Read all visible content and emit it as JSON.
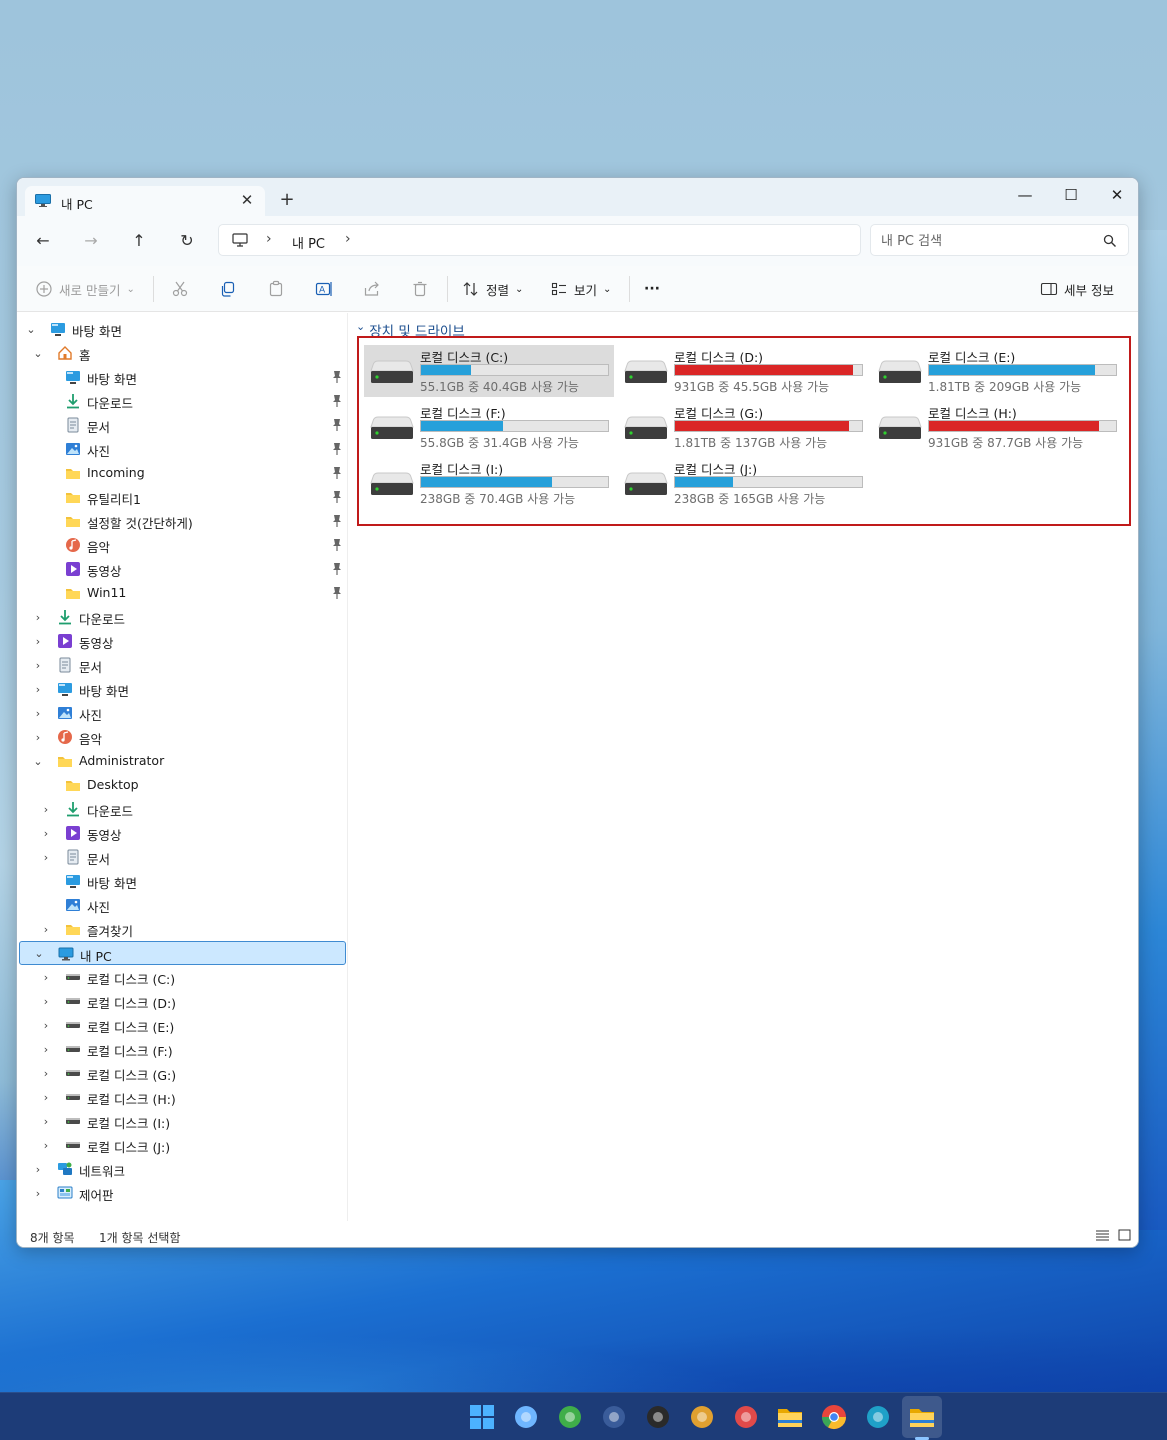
{
  "window": {
    "tab_title": "내 PC",
    "tab_close": "✕",
    "new_tab": "+",
    "minimize": "—",
    "maximize": "☐",
    "close": "✕"
  },
  "nav": {
    "back": "←",
    "forward": "→",
    "up": "↑",
    "refresh": "↻",
    "breadcrumb": [
      "내 PC"
    ],
    "sep": "›",
    "search_placeholder": "내 PC 검색"
  },
  "toolbar": {
    "new_label": "새로 만들기",
    "sort_label": "정렬",
    "view_label": "보기",
    "more_label": "···",
    "details_label": "세부 정보",
    "dropdown": "⌄"
  },
  "sidebar": {
    "items": [
      {
        "label": "바탕 화면",
        "icon": "desktop-icon",
        "level": 0,
        "chevron": "⌄"
      },
      {
        "label": "홈",
        "icon": "home-icon",
        "level": 1,
        "chevron": "⌄"
      },
      {
        "label": "바탕 화면",
        "icon": "desktop-icon",
        "level": 2,
        "pinned": true
      },
      {
        "label": "다운로드",
        "icon": "download-icon",
        "level": 2,
        "pinned": true
      },
      {
        "label": "문서",
        "icon": "document-icon",
        "level": 2,
        "pinned": true
      },
      {
        "label": "사진",
        "icon": "pictures-icon",
        "level": 2,
        "pinned": true
      },
      {
        "label": "Incoming",
        "icon": "folder-icon",
        "level": 2,
        "pinned": true
      },
      {
        "label": "유틸리티1",
        "icon": "folder-icon",
        "level": 2,
        "pinned": true
      },
      {
        "label": "설정할 것(간단하게)",
        "icon": "folder-icon",
        "level": 2,
        "pinned": true
      },
      {
        "label": "음악",
        "icon": "music-icon",
        "level": 2,
        "pinned": true
      },
      {
        "label": "동영상",
        "icon": "video-icon",
        "level": 2,
        "pinned": true
      },
      {
        "label": "Win11",
        "icon": "folder-icon",
        "level": 2,
        "pinned": true
      },
      {
        "label": "다운로드",
        "icon": "download-icon",
        "level": 1,
        "chevron": "›"
      },
      {
        "label": "동영상",
        "icon": "video-icon",
        "level": 1,
        "chevron": "›"
      },
      {
        "label": "문서",
        "icon": "document-icon",
        "level": 1,
        "chevron": "›"
      },
      {
        "label": "바탕 화면",
        "icon": "desktop-icon",
        "level": 1,
        "chevron": "›"
      },
      {
        "label": "사진",
        "icon": "pictures-icon",
        "level": 1,
        "chevron": "›"
      },
      {
        "label": "음악",
        "icon": "music-icon",
        "level": 1,
        "chevron": "›"
      },
      {
        "label": "Administrator",
        "icon": "folder-icon",
        "level": 1,
        "chevron": "⌄"
      },
      {
        "label": "Desktop",
        "icon": "folder-icon",
        "level": 2
      },
      {
        "label": "다운로드",
        "icon": "download-icon",
        "level": 2,
        "chevron": "›"
      },
      {
        "label": "동영상",
        "icon": "video-icon",
        "level": 2,
        "chevron": "›"
      },
      {
        "label": "문서",
        "icon": "document-icon",
        "level": 2,
        "chevron": "›"
      },
      {
        "label": "바탕 화면",
        "icon": "desktop-icon",
        "level": 2
      },
      {
        "label": "사진",
        "icon": "pictures-icon",
        "level": 2
      },
      {
        "label": "즐겨찾기",
        "icon": "folder-icon",
        "level": 2,
        "chevron": "›"
      },
      {
        "label": "내 PC",
        "icon": "pc-icon",
        "level": 1,
        "chevron": "⌄",
        "selected": true
      },
      {
        "label": "로컬 디스크 (C:)",
        "icon": "drive-icon",
        "level": 2,
        "chevron": "›"
      },
      {
        "label": "로컬 디스크 (D:)",
        "icon": "drive-icon",
        "level": 2,
        "chevron": "›"
      },
      {
        "label": "로컬 디스크 (E:)",
        "icon": "drive-icon",
        "level": 2,
        "chevron": "›"
      },
      {
        "label": "로컬 디스크 (F:)",
        "icon": "drive-icon",
        "level": 2,
        "chevron": "›"
      },
      {
        "label": "로컬 디스크 (G:)",
        "icon": "drive-icon",
        "level": 2,
        "chevron": "›"
      },
      {
        "label": "로컬 디스크 (H:)",
        "icon": "drive-icon",
        "level": 2,
        "chevron": "›"
      },
      {
        "label": "로컬 디스크 (I:)",
        "icon": "drive-icon",
        "level": 2,
        "chevron": "›"
      },
      {
        "label": "로컬 디스크 (J:)",
        "icon": "drive-icon",
        "level": 2,
        "chevron": "›"
      },
      {
        "label": "네트워크",
        "icon": "network-icon",
        "level": 1,
        "chevron": "›"
      },
      {
        "label": "제어판",
        "icon": "control-panel-icon",
        "level": 1,
        "chevron": "›"
      }
    ]
  },
  "content": {
    "group_chevron": "⌄",
    "group_title": "장치 및 드라이브",
    "drives": [
      {
        "name": "로컬 디스크 (C:)",
        "space": "55.1GB 중 40.4GB 사용 가능",
        "used_fraction": 0.27,
        "status": "normal",
        "selected": true
      },
      {
        "name": "로컬 디스크 (D:)",
        "space": "931GB 중 45.5GB 사용 가능",
        "used_fraction": 0.95,
        "status": "full"
      },
      {
        "name": "로컬 디스크 (E:)",
        "space": "1.81TB 중 209GB 사용 가능",
        "used_fraction": 0.89,
        "status": "normal"
      },
      {
        "name": "로컬 디스크 (F:)",
        "space": "55.8GB 중 31.4GB 사용 가능",
        "used_fraction": 0.44,
        "status": "normal"
      },
      {
        "name": "로컬 디스크 (G:)",
        "space": "1.81TB 중 137GB 사용 가능",
        "used_fraction": 0.93,
        "status": "full"
      },
      {
        "name": "로컬 디스크 (H:)",
        "space": "931GB 중 87.7GB 사용 가능",
        "used_fraction": 0.91,
        "status": "full"
      },
      {
        "name": "로컬 디스크 (I:)",
        "space": "238GB 중 70.4GB 사용 가능",
        "used_fraction": 0.7,
        "status": "normal"
      },
      {
        "name": "로컬 디스크 (J:)",
        "space": "238GB 중 165GB 사용 가능",
        "used_fraction": 0.31,
        "status": "normal"
      }
    ]
  },
  "status": {
    "item_count": "8개 항목",
    "selected_count": "1개 항목 선택함"
  },
  "taskbar": {
    "icons": [
      "start-icon",
      "search-remote-icon",
      "utorrent-icon",
      "app-1d-icon",
      "calendar-321-icon",
      "eye-app-icon",
      "eraser-app-icon",
      "file-explorer-icon",
      "chrome-icon",
      "edge-can-icon",
      "file-explorer-active-icon"
    ]
  },
  "colors": {
    "bar_normal": "#26a0da",
    "bar_full": "#da2626",
    "highlight": "#c01a1a",
    "selection": "#cce8ff"
  }
}
